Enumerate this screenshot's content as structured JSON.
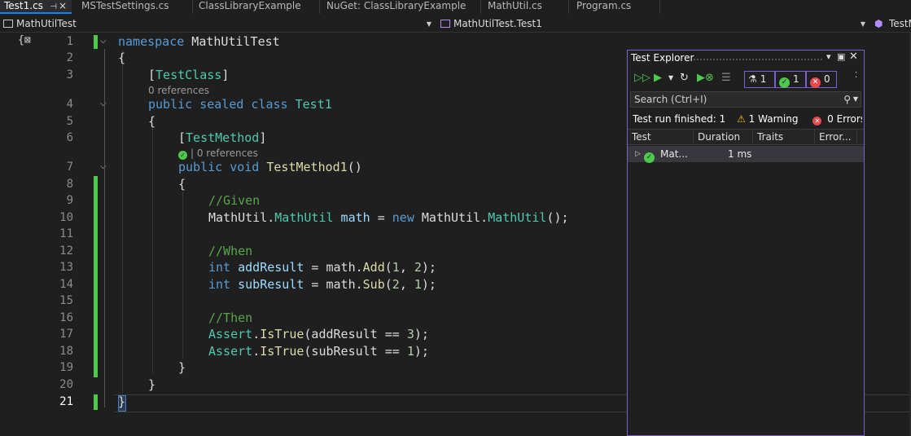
{
  "tabs": [
    {
      "label": "Test1.cs",
      "active": true
    },
    {
      "label": "MSTestSettings.cs"
    },
    {
      "label": "ClassLibraryExample"
    },
    {
      "label": "NuGet: ClassLibraryExample"
    },
    {
      "label": "MathUtil.cs"
    },
    {
      "label": "Program.cs"
    }
  ],
  "navbar": {
    "project": "MathUtilTest",
    "member": "MathUtilTest.Test1",
    "right": "TestM"
  },
  "editor": {
    "lines": [
      "1",
      "2",
      "3",
      "4",
      "5",
      "6",
      "7",
      "8",
      "9",
      "10",
      "11",
      "12",
      "13",
      "14",
      "15",
      "16",
      "17",
      "18",
      "19",
      "20",
      "21"
    ],
    "code": {
      "l1_kw": "namespace",
      "l1_name": " MathUtilTest",
      "l2": "{",
      "l3_open": "[",
      "l3_attr": "TestClass",
      "l3_close": "]",
      "lens1": "0 references",
      "l4_kw": "public sealed class",
      "l4_name": " Test1",
      "l5": "{",
      "l6_open": "[",
      "l6_attr": "TestMethod",
      "l6_close": "]",
      "lens2": "| 0 references",
      "l7_kw": "public void",
      "l7_fn": " TestMethod1",
      "l7_rest": "()",
      "l8": "{",
      "l9": "//Given",
      "l10_a": "MathUtil.",
      "l10_b": "MathUtil",
      "l10_c": " math",
      "l10_d": " = ",
      "l10_e": "new",
      "l10_f": " MathUtil.",
      "l10_g": "MathUtil",
      "l10_h": "();",
      "l12": "//When",
      "l13_kw": "int",
      "l13_var": " addResult",
      "l13_a": " = math.",
      "l13_fn": "Add",
      "l13_b": "(",
      "l13_n1": "1",
      "l13_c": ", ",
      "l13_n2": "2",
      "l13_d": ");",
      "l14_kw": "int",
      "l14_var": " subResult",
      "l14_a": " = math.",
      "l14_fn": "Sub",
      "l14_b": "(",
      "l14_n1": "2",
      "l14_c": ", ",
      "l14_n2": "1",
      "l14_d": ");",
      "l16": "//Then",
      "l17_ty": "Assert",
      "l17_a": ".",
      "l17_fn": "IsTrue",
      "l17_b": "(addResult == ",
      "l17_n": "3",
      "l17_c": ");",
      "l18_ty": "Assert",
      "l18_a": ".",
      "l18_fn": "IsTrue",
      "l18_b": "(subResult == ",
      "l18_n": "1",
      "l18_c": ");",
      "l19": "}",
      "l20": "}",
      "l21": "}"
    }
  },
  "test_explorer": {
    "title": "Test Explorer",
    "counts": {
      "total": "1",
      "passed": "1",
      "failed": "0"
    },
    "search_placeholder": "Search (Ctrl+I)",
    "status": "Test run finished: 1 ",
    "warning": "1 Warning",
    "errors": "0 Errors",
    "columns": [
      "Test",
      "Duration",
      "Traits",
      "Error..."
    ],
    "rows": [
      {
        "test": "Mat...",
        "duration": "1 ms"
      }
    ]
  },
  "colors": {
    "accent": "#7b5ecf",
    "pass": "#4ec94e",
    "fail": "#e5484d",
    "changed": "#4ec94e"
  }
}
